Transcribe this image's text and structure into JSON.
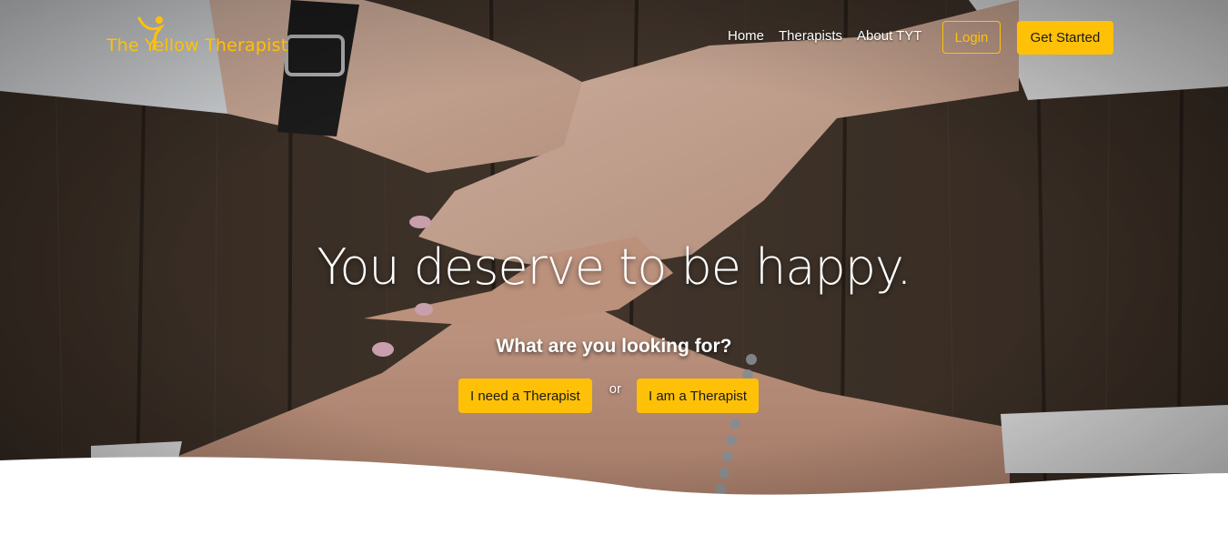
{
  "brand": {
    "name": "The Yellow Therapist",
    "color": "#ffc107"
  },
  "nav": {
    "links": [
      "Home",
      "Therapists",
      "About TYT"
    ],
    "login_label": "Login",
    "get_started_label": "Get Started"
  },
  "hero": {
    "headline": "You deserve to be happy.",
    "question": "What are you looking for?",
    "need_therapist_label": "I need a Therapist",
    "or_label": "or",
    "am_therapist_label": "I am a Therapist",
    "background_image": "hands-holding-photo"
  },
  "colors": {
    "accent": "#ffc107",
    "text_on_image": "#ffffff"
  }
}
